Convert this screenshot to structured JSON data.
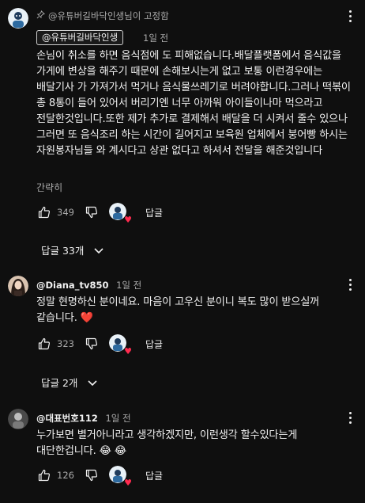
{
  "comments": [
    {
      "pinned_by": "@유튜버길바닥인생님이 고정함",
      "author": "@유튜버길바닥인생",
      "time": "1일 전",
      "text": "손님이 취소를 하면 음식점에 도 피해없습니다.배달플랫폼에서 음식값을 가게에 변상을 해주기 때문에 손해보시는게 없고 보통 이런경우에는 배달기사 가 가져가서 먹거나 음식물쓰레기로 버려야합니다.그러나 떡볶이 총 8통이 들어 있어서 버리기엔 너무 아까워 아이들이나마 먹으라고 전달한것입니다.또한 제가 추가로 결제해서 배달을 더 시켜서 줄수 있으나 그러면 또 음식조리 하는 시간이 길어지고 보육원 업체에서 붕어빵 하시는 자원봉자님들 와 계시다고 상관 없다고 하셔서 전달을 해준것입니다",
      "read_more": "간략히",
      "likes": "349",
      "reply_label": "답글",
      "replies_toggle": "답글 33개"
    },
    {
      "author": "@Diana_tv850",
      "time": "1일 전",
      "text": "정말 현명하신 분이네요. 마음이 고우신 분이니 복도 많이 받으실꺼 같습니다. ❤️",
      "likes": "323",
      "reply_label": "답글",
      "replies_toggle": "답글 2개"
    },
    {
      "author": "@대표번호112",
      "time": "1일 전",
      "text": "누가보면 별거아니라고 생각하겠지만, 이런생각 할수있다는게 대단한겁니다. 😂 😂",
      "likes": "126",
      "reply_label": "답글"
    }
  ],
  "icons": {
    "pin": "pin-icon",
    "more": "more-vert-icon",
    "like": "thumb-up-icon",
    "dislike": "thumb-down-icon",
    "chevron": "chevron-down-icon",
    "heart": "creator-heart-icon"
  },
  "colors": {
    "background": "#0f0f0f",
    "text": "#f1f1f1",
    "secondary": "#aaaaaa",
    "heart": "#ff2b4f"
  }
}
